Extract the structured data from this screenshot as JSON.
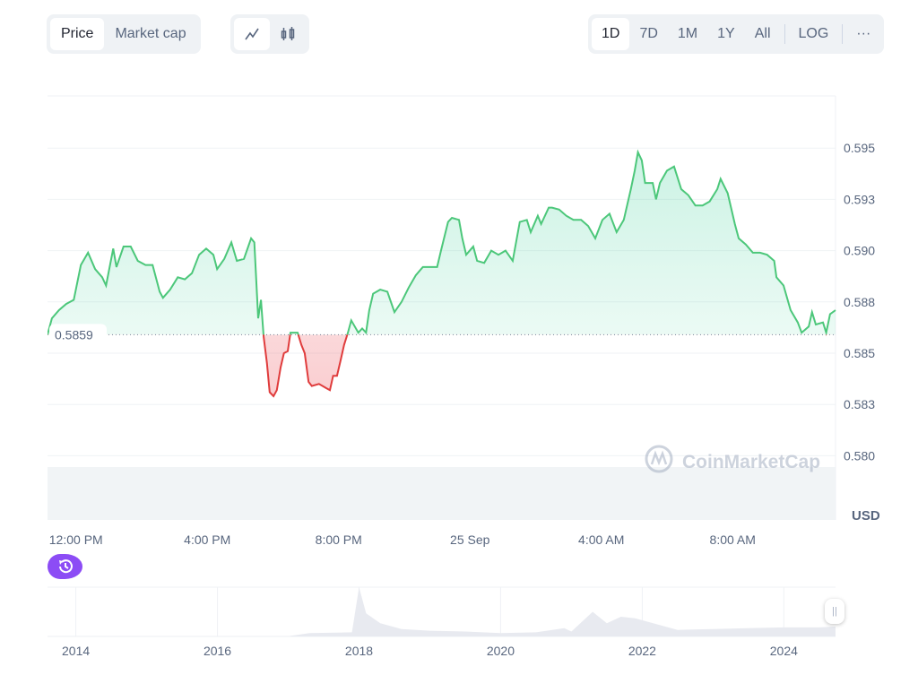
{
  "toolbar": {
    "metric_tabs": [
      {
        "label": "Price",
        "active": true
      },
      {
        "label": "Market cap",
        "active": false
      }
    ],
    "chart_types": [
      {
        "icon": "line-chart-icon",
        "active": true
      },
      {
        "icon": "candlestick-icon",
        "active": false
      }
    ],
    "ranges": [
      {
        "label": "1D",
        "active": true
      },
      {
        "label": "7D"
      },
      {
        "label": "1M"
      },
      {
        "label": "1Y"
      },
      {
        "label": "All"
      }
    ],
    "log_label": "LOG",
    "more_label": "···"
  },
  "colors": {
    "up": "#16c784",
    "up_line": "#4cc77a",
    "down": "#ea3943",
    "grid": "#eff2f5",
    "accent": "#8c4cf5"
  },
  "watermark": "CoinMarketCap",
  "chart_data": {
    "type": "area",
    "ylabel": "USD",
    "yticks": [
      "0.595",
      "0.593",
      "0.590",
      "0.588",
      "0.585",
      "0.583",
      "0.580"
    ],
    "ytick_values": [
      0.595,
      0.5925,
      0.59,
      0.5875,
      0.585,
      0.5825,
      0.58
    ],
    "ylim": [
      0.5781,
      0.5966
    ],
    "xticks": [
      "12:00 PM",
      "4:00 PM",
      "8:00 PM",
      "25 Sep",
      "4:00 AM",
      "8:00 AM"
    ],
    "xtick_times": [
      "24 Sep 12:00",
      "24 Sep 16:00",
      "24 Sep 20:00",
      "25 Sep 00:00",
      "25 Sep 04:00",
      "25 Sep 08:00"
    ],
    "baseline": 0.5859,
    "baseline_label": "0.5859",
    "grid": true,
    "points": [
      [
        "24 Sep 11:08",
        0.5859
      ],
      [
        "24 Sep 11:16",
        0.5867
      ],
      [
        "24 Sep 11:29",
        0.5871
      ],
      [
        "24 Sep 11:42",
        0.5874
      ],
      [
        "24 Sep 11:56",
        0.5876
      ],
      [
        "24 Sep 12:09",
        0.5893
      ],
      [
        "24 Sep 12:22",
        0.5899
      ],
      [
        "24 Sep 12:35",
        0.5891
      ],
      [
        "24 Sep 12:48",
        0.5887
      ],
      [
        "24 Sep 12:55",
        0.5883
      ],
      [
        "24 Sep 13:08",
        0.5901
      ],
      [
        "24 Sep 13:14",
        0.5892
      ],
      [
        "24 Sep 13:27",
        0.5902
      ],
      [
        "24 Sep 13:40",
        0.5902
      ],
      [
        "24 Sep 13:53",
        0.5895
      ],
      [
        "24 Sep 14:07",
        0.5893
      ],
      [
        "24 Sep 14:20",
        0.5893
      ],
      [
        "24 Sep 14:33",
        0.588
      ],
      [
        "24 Sep 14:39",
        0.5877
      ],
      [
        "24 Sep 14:52",
        0.5881
      ],
      [
        "24 Sep 15:06",
        0.5887
      ],
      [
        "24 Sep 15:19",
        0.5886
      ],
      [
        "24 Sep 15:32",
        0.5889
      ],
      [
        "24 Sep 15:45",
        0.5898
      ],
      [
        "24 Sep 15:58",
        0.5901
      ],
      [
        "24 Sep 16:11",
        0.5898
      ],
      [
        "24 Sep 16:18",
        0.5891
      ],
      [
        "24 Sep 16:31",
        0.5896
      ],
      [
        "24 Sep 16:44",
        0.5904
      ],
      [
        "24 Sep 16:54",
        0.5895
      ],
      [
        "24 Sep 17:07",
        0.5896
      ],
      [
        "24 Sep 17:20",
        0.5906
      ],
      [
        "24 Sep 17:26",
        0.5904
      ],
      [
        "24 Sep 17:33",
        0.5867
      ],
      [
        "24 Sep 17:38",
        0.5876
      ],
      [
        "24 Sep 17:43",
        0.5858
      ],
      [
        "24 Sep 17:49",
        0.5845
      ],
      [
        "24 Sep 17:54",
        0.5831
      ],
      [
        "24 Sep 18:01",
        0.5829
      ],
      [
        "24 Sep 18:07",
        0.5832
      ],
      [
        "24 Sep 18:14",
        0.5843
      ],
      [
        "24 Sep 18:20",
        0.585
      ],
      [
        "24 Sep 18:27",
        0.5851
      ],
      [
        "24 Sep 18:32",
        0.586
      ],
      [
        "24 Sep 18:45",
        0.586
      ],
      [
        "24 Sep 18:52",
        0.5854
      ],
      [
        "24 Sep 18:58",
        0.585
      ],
      [
        "24 Sep 19:05",
        0.5836
      ],
      [
        "24 Sep 19:11",
        0.5834
      ],
      [
        "24 Sep 19:24",
        0.5835
      ],
      [
        "24 Sep 19:37",
        0.5833
      ],
      [
        "24 Sep 19:44",
        0.5832
      ],
      [
        "24 Sep 19:50",
        0.5839
      ],
      [
        "24 Sep 19:57",
        0.5839
      ],
      [
        "24 Sep 20:04",
        0.5847
      ],
      [
        "24 Sep 20:10",
        0.5854
      ],
      [
        "24 Sep 20:17",
        0.586
      ],
      [
        "24 Sep 20:23",
        0.5866
      ],
      [
        "24 Sep 20:36",
        0.586
      ],
      [
        "24 Sep 20:43",
        0.5862
      ],
      [
        "24 Sep 20:50",
        0.586
      ],
      [
        "24 Sep 20:56",
        0.5871
      ],
      [
        "24 Sep 21:03",
        0.5879
      ],
      [
        "24 Sep 21:16",
        0.5881
      ],
      [
        "24 Sep 21:29",
        0.588
      ],
      [
        "24 Sep 21:42",
        0.587
      ],
      [
        "24 Sep 21:55",
        0.5875
      ],
      [
        "24 Sep 22:08",
        0.5882
      ],
      [
        "24 Sep 22:21",
        0.5888
      ],
      [
        "24 Sep 22:34",
        0.5892
      ],
      [
        "24 Sep 22:47",
        0.5892
      ],
      [
        "24 Sep 23:00",
        0.5892
      ],
      [
        "24 Sep 23:07",
        0.59
      ],
      [
        "24 Sep 23:20",
        0.5914
      ],
      [
        "24 Sep 23:27",
        0.5916
      ],
      [
        "24 Sep 23:40",
        0.5915
      ],
      [
        "24 Sep 23:46",
        0.5906
      ],
      [
        "24 Sep 23:53",
        0.5898
      ],
      [
        "25 Sep 00:06",
        0.5902
      ],
      [
        "25 Sep 00:13",
        0.5895
      ],
      [
        "25 Sep 00:26",
        0.5894
      ],
      [
        "25 Sep 00:39",
        0.59
      ],
      [
        "25 Sep 00:52",
        0.5898
      ],
      [
        "25 Sep 01:05",
        0.59
      ],
      [
        "25 Sep 01:18",
        0.5895
      ],
      [
        "25 Sep 01:31",
        0.5914
      ],
      [
        "25 Sep 01:44",
        0.5915
      ],
      [
        "25 Sep 01:51",
        0.5909
      ],
      [
        "25 Sep 02:04",
        0.5917
      ],
      [
        "25 Sep 02:10",
        0.5913
      ],
      [
        "25 Sep 02:24",
        0.5921
      ],
      [
        "25 Sep 02:30",
        0.5921
      ],
      [
        "25 Sep 02:43",
        0.592
      ],
      [
        "25 Sep 02:56",
        0.5917
      ],
      [
        "25 Sep 03:09",
        0.5915
      ],
      [
        "25 Sep 03:23",
        0.5915
      ],
      [
        "25 Sep 03:36",
        0.5912
      ],
      [
        "25 Sep 03:49",
        0.5906
      ],
      [
        "25 Sep 04:02",
        0.5915
      ],
      [
        "25 Sep 04:15",
        0.5918
      ],
      [
        "25 Sep 04:28",
        0.5909
      ],
      [
        "25 Sep 04:41",
        0.5915
      ],
      [
        "25 Sep 04:54",
        0.593
      ],
      [
        "25 Sep 05:01",
        0.5939
      ],
      [
        "25 Sep 05:07",
        0.5948
      ],
      [
        "25 Sep 05:14",
        0.5944
      ],
      [
        "25 Sep 05:20",
        0.5933
      ],
      [
        "25 Sep 05:34",
        0.5933
      ],
      [
        "25 Sep 05:40",
        0.5925
      ],
      [
        "25 Sep 05:47",
        0.5933
      ],
      [
        "25 Sep 06:00",
        0.5939
      ],
      [
        "25 Sep 06:13",
        0.5941
      ],
      [
        "25 Sep 06:26",
        0.593
      ],
      [
        "25 Sep 06:39",
        0.5927
      ],
      [
        "25 Sep 06:52",
        0.5922
      ],
      [
        "25 Sep 07:05",
        0.5922
      ],
      [
        "25 Sep 07:18",
        0.5924
      ],
      [
        "25 Sep 07:32",
        0.593
      ],
      [
        "25 Sep 07:38",
        0.5935
      ],
      [
        "25 Sep 07:51",
        0.5928
      ],
      [
        "25 Sep 08:04",
        0.5913
      ],
      [
        "25 Sep 08:11",
        0.5906
      ],
      [
        "25 Sep 08:24",
        0.5903
      ],
      [
        "25 Sep 08:37",
        0.5899
      ],
      [
        "25 Sep 08:50",
        0.5899
      ],
      [
        "25 Sep 09:03",
        0.5898
      ],
      [
        "25 Sep 09:16",
        0.5895
      ],
      [
        "25 Sep 09:20",
        0.5887
      ],
      [
        "25 Sep 09:33",
        0.5883
      ],
      [
        "25 Sep 09:46",
        0.5871
      ],
      [
        "25 Sep 09:59",
        0.5865
      ],
      [
        "25 Sep 10:06",
        0.586
      ],
      [
        "25 Sep 10:19",
        0.5863
      ],
      [
        "25 Sep 10:25",
        0.587
      ],
      [
        "25 Sep 10:32",
        0.5864
      ],
      [
        "25 Sep 10:45",
        0.5865
      ],
      [
        "25 Sep 10:51",
        0.586
      ],
      [
        "25 Sep 10:58",
        0.5869
      ],
      [
        "25 Sep 11:08",
        0.5871
      ]
    ]
  },
  "navigator": {
    "type": "area",
    "xticks": [
      "2014",
      "2016",
      "2018",
      "2020",
      "2022",
      "2024"
    ],
    "years": [
      2013.6,
      2014,
      2015,
      2016,
      2017,
      2017.3,
      2017.9,
      2018.0,
      2018.1,
      2018.3,
      2018.6,
      2019,
      2019.5,
      2020,
      2020.5,
      2020.9,
      2021.0,
      2021.3,
      2021.5,
      2021.7,
      2021.9,
      2022.2,
      2022.5,
      2023,
      2023.5,
      2024,
      2024.5,
      2024.73
    ],
    "values": [
      0.01,
      0.02,
      0.01,
      0.01,
      0.01,
      0.2,
      0.25,
      3.0,
      1.4,
      0.8,
      0.45,
      0.35,
      0.3,
      0.2,
      0.25,
      0.5,
      0.3,
      1.5,
      0.8,
      1.2,
      1.1,
      0.75,
      0.4,
      0.45,
      0.5,
      0.55,
      0.55,
      0.6
    ]
  },
  "history_button": "history-icon"
}
